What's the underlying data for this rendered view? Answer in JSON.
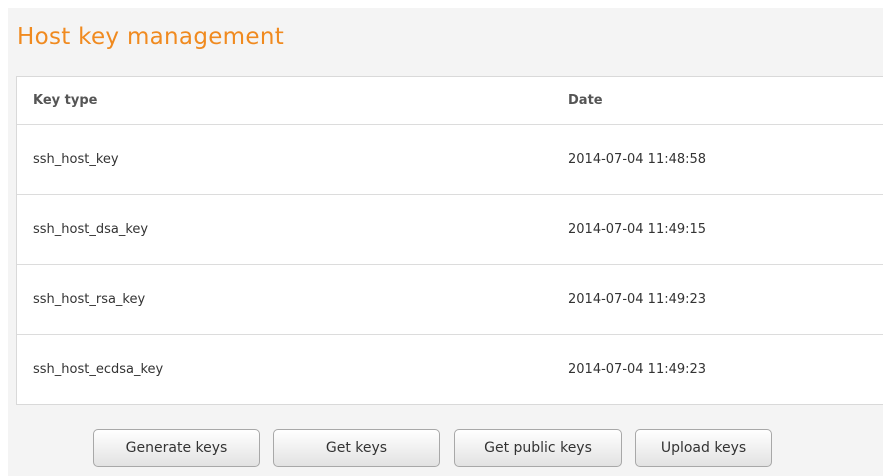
{
  "page": {
    "title": "Host key management"
  },
  "table": {
    "columns": [
      "Key type",
      "Date"
    ],
    "rows": [
      {
        "key_type": "ssh_host_key",
        "date": "2014-07-04 11:48:58"
      },
      {
        "key_type": "ssh_host_dsa_key",
        "date": "2014-07-04 11:49:15"
      },
      {
        "key_type": "ssh_host_rsa_key",
        "date": "2014-07-04 11:49:23"
      },
      {
        "key_type": "ssh_host_ecdsa_key",
        "date": "2014-07-04 11:49:23"
      }
    ]
  },
  "actions": {
    "generate_label": "Generate keys",
    "get_keys_label": "Get keys",
    "get_public_keys_label": "Get public keys",
    "upload_label": "Upload keys"
  },
  "colors": {
    "title": "#f08a1f",
    "panel_background": "#f4f4f4",
    "table_background": "#ffffff"
  }
}
